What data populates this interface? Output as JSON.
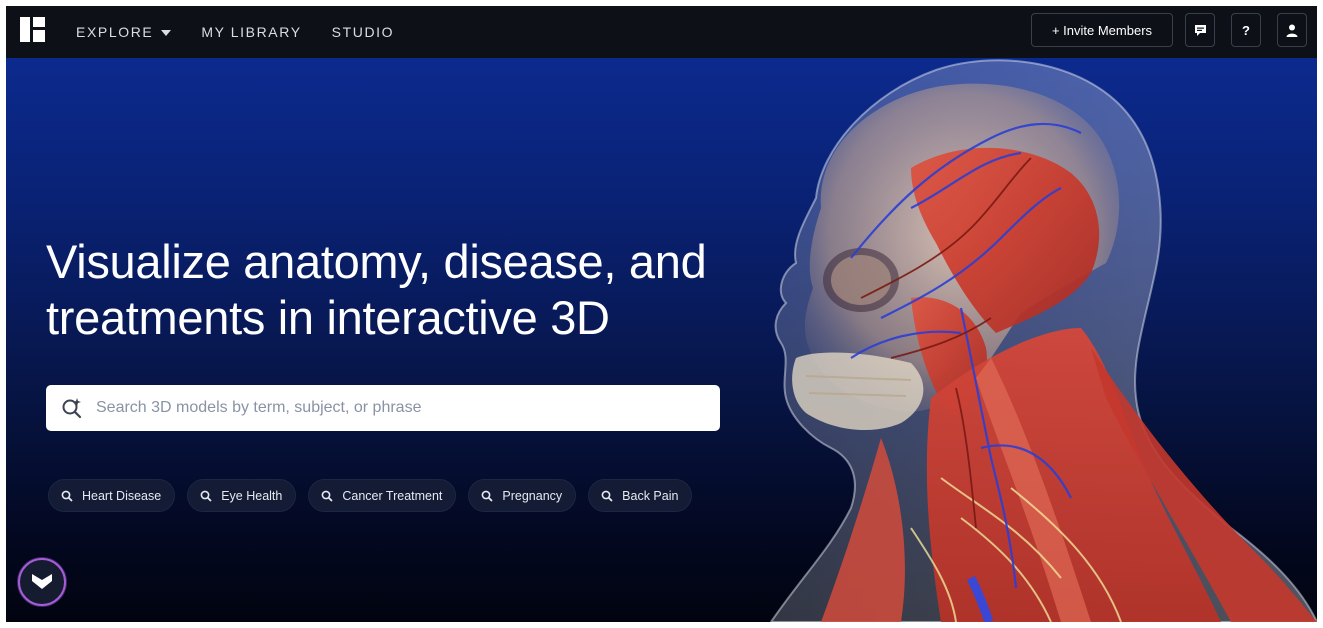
{
  "nav": {
    "items": [
      {
        "label": "EXPLORE",
        "has_dropdown": true
      },
      {
        "label": "MY LIBRARY",
        "has_dropdown": false
      },
      {
        "label": "STUDIO",
        "has_dropdown": false
      }
    ],
    "invite_label": "+ Invite Members",
    "icons": [
      "chat-icon",
      "help-icon",
      "user-icon"
    ],
    "help_glyph": "?"
  },
  "hero": {
    "headline": "Visualize anatomy, disease, and treatments in interactive 3D",
    "search_placeholder": "Search 3D models by term, subject, or phrase",
    "chips": [
      {
        "label": "Heart Disease"
      },
      {
        "label": "Eye Health"
      },
      {
        "label": "Cancer Treatment"
      },
      {
        "label": "Pregnancy"
      },
      {
        "label": "Back Pain"
      }
    ]
  },
  "colors": {
    "nav_bg": "#0d1017",
    "hero_top": "#0c2a8e",
    "hero_bottom": "#01040f",
    "scroll_ring": "#a85bd8"
  }
}
